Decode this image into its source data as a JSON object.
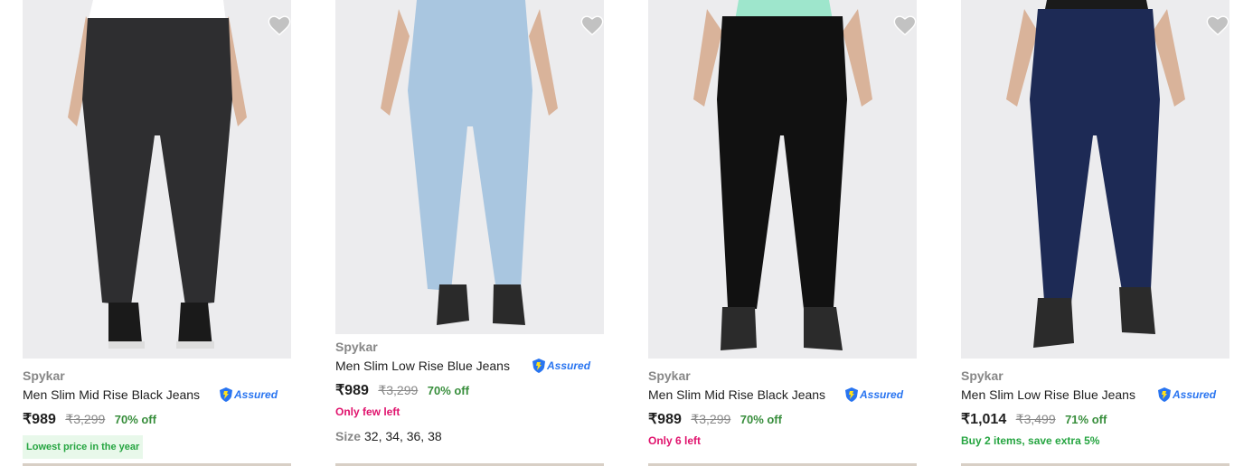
{
  "colors": {
    "price_green": "#388e3c",
    "stock_pink": "#e0136d",
    "assured_blue": "#2874f0",
    "heart_gray": "#c2c2c2"
  },
  "products": [
    {
      "brand": "Spykar",
      "title": "Men Slim Mid Rise Black Jeans",
      "assured": "Assured",
      "price": "₹989",
      "mrp": "₹3,299",
      "discount": "70% off",
      "note": "Lowest price in the year",
      "note_style": "badge",
      "jeans_color": "#2e2e30",
      "icon": "heart-wishlist-icon"
    },
    {
      "brand": "Spykar",
      "title": "Men Slim Low Rise Blue Jeans",
      "assured": "Assured",
      "price": "₹989",
      "mrp": "₹3,299",
      "discount": "70% off",
      "note": "Only few left",
      "note_style": "pink",
      "size_label": "Size",
      "sizes": "32, 34, 36, 38",
      "jeans_color": "#a9c6e0",
      "icon": "heart-wishlist-icon"
    },
    {
      "brand": "Spykar",
      "title": "Men Slim Mid Rise Black Jeans",
      "assured": "Assured",
      "price": "₹989",
      "mrp": "₹3,299",
      "discount": "70% off",
      "note": "Only 6 left",
      "note_style": "pink",
      "jeans_color": "#111111",
      "icon": "heart-wishlist-icon"
    },
    {
      "brand": "Spykar",
      "title": "Men Slim Low Rise Blue Jeans",
      "assured": "Assured",
      "price": "₹1,014",
      "mrp": "₹3,499",
      "discount": "71% off",
      "note": "Buy 2 items, save extra 5%",
      "note_style": "green",
      "jeans_color": "#1d2a55",
      "icon": "heart-wishlist-icon"
    }
  ]
}
